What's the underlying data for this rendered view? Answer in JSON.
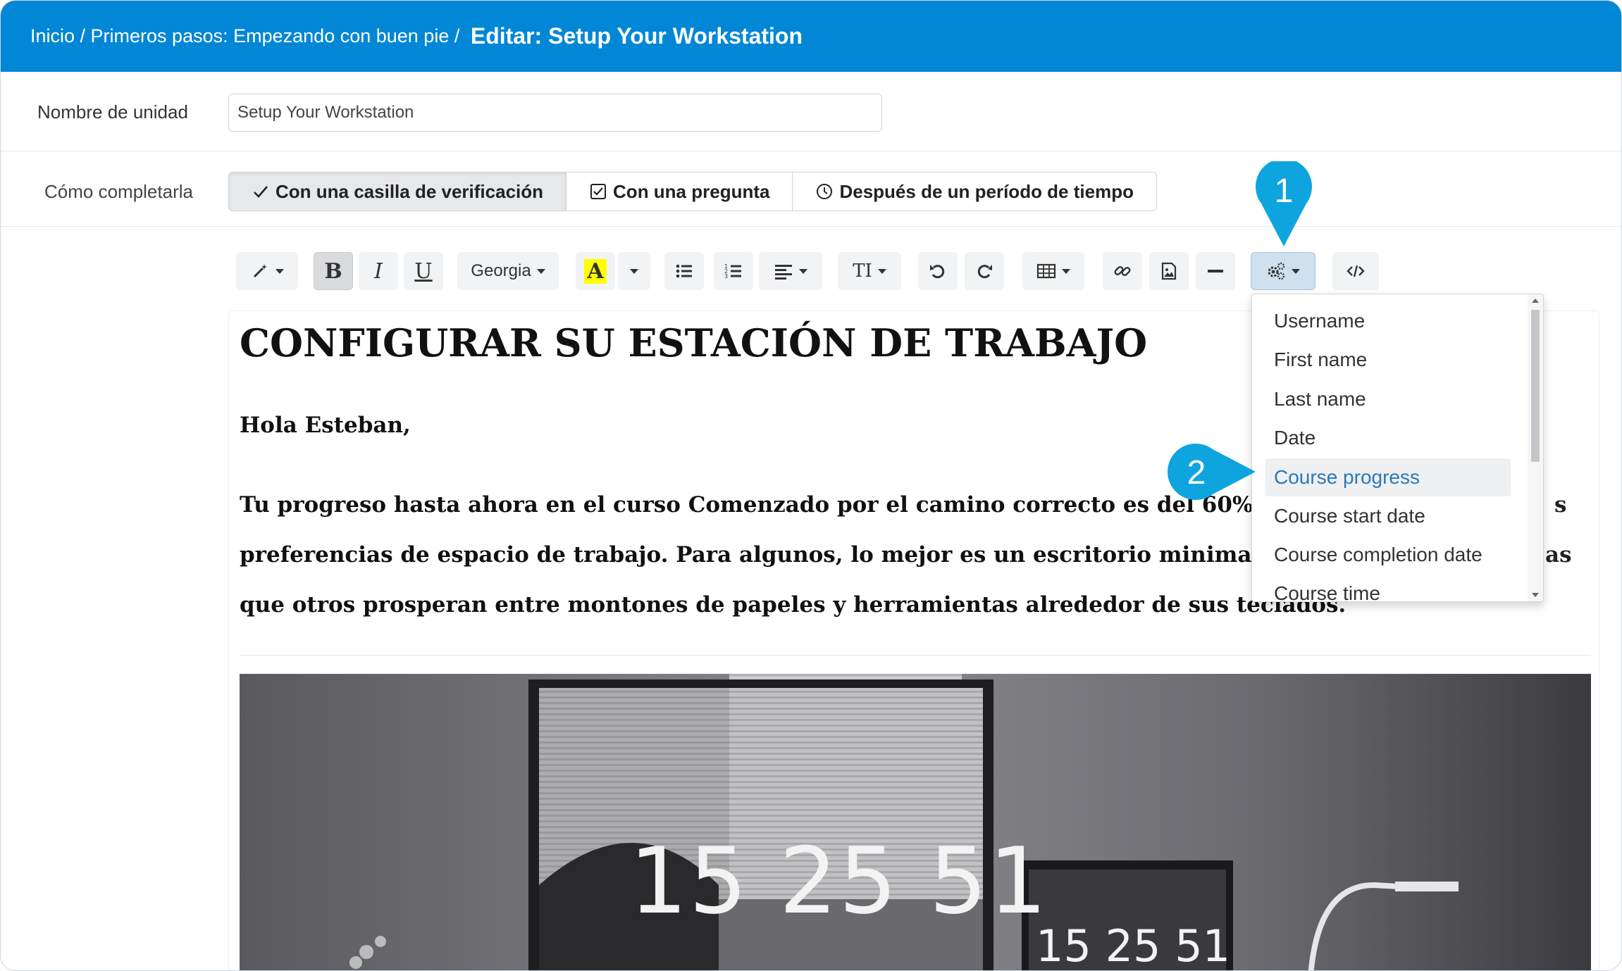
{
  "breadcrumb": {
    "items": [
      "Inicio",
      "Primeros pasos: Empezando con buen pie"
    ],
    "separator": " / ",
    "current": "Editar: Setup Your Workstation"
  },
  "unit_name": {
    "label": "Nombre de unidad",
    "value": "Setup Your Workstation"
  },
  "completion": {
    "label": "Cómo completarla",
    "options": [
      {
        "label": "Con una casilla de verificación",
        "icon": "check-icon",
        "selected": true
      },
      {
        "label": "Con una pregunta",
        "icon": "checkbox-icon",
        "selected": false
      },
      {
        "label": "Después de un período de tiempo",
        "icon": "clock-icon",
        "selected": false
      }
    ]
  },
  "toolbar": {
    "font_name": "Georgia",
    "highlight_letter": "A",
    "text_size_icon": "TI",
    "bold": "B",
    "italic": "I",
    "underline": "U"
  },
  "placeholder_menu": {
    "items": [
      "Username",
      "First name",
      "Last name",
      "Date",
      "Course progress",
      "Course start date",
      "Course completion date",
      "Course time"
    ],
    "highlighted": "Course progress"
  },
  "editor": {
    "title": "CONFIGURAR SU ESTACIÓN DE TRABAJO",
    "greeting": "Hola Esteban,",
    "paragraph_lines": [
      "Tu progreso hasta ahora en el curso Comenzado por el camino correcto es del 60%.",
      "preferencias de espacio de trabajo. Para algunos, lo mejor es un escritorio minimali",
      "que otros prosperan entre montones de papeles y herramientas alrededor de sus teclados."
    ],
    "paragraph_fragments_right": [
      "s",
      "as"
    ],
    "photo_clock_large": "15 25 51",
    "photo_clock_small": "15 25 51"
  },
  "callouts": [
    "1",
    "2"
  ],
  "colors": {
    "header": "#0287d6",
    "callout": "#0ea5df",
    "highlight_yellow": "#ffff00",
    "link_blue": "#2b79b8"
  }
}
